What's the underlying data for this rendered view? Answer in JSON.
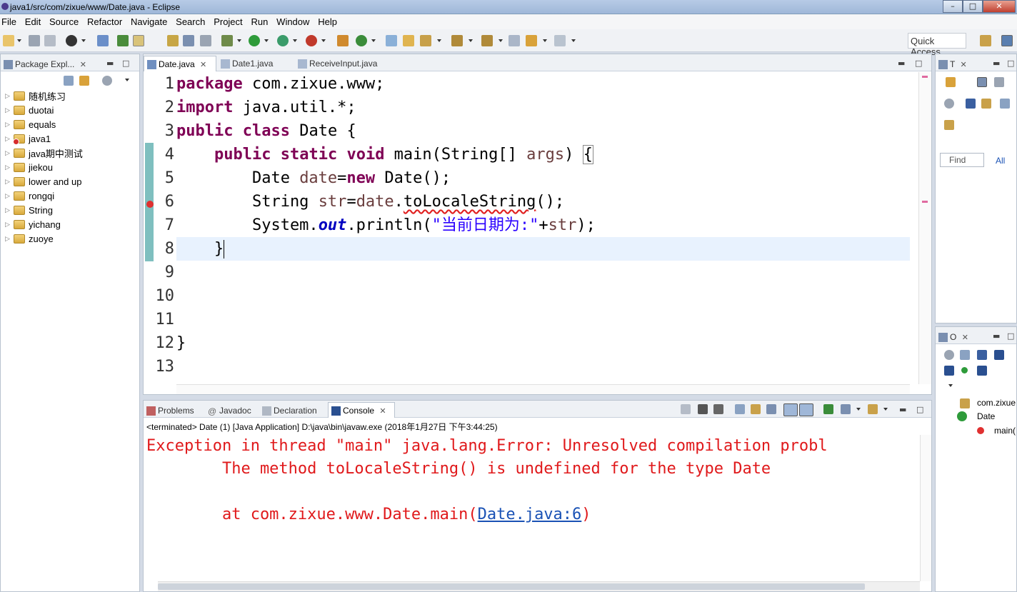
{
  "window": {
    "title": "java1/src/com/zixue/www/Date.java - Eclipse",
    "min_label": "–",
    "max_label": "□",
    "close_label": "✕"
  },
  "menu": [
    "File",
    "Edit",
    "Source",
    "Refactor",
    "Navigate",
    "Search",
    "Project",
    "Run",
    "Window",
    "Help"
  ],
  "toolbar": {
    "quick_access": "Quick Access"
  },
  "package_explorer": {
    "tab_label": "Package Expl...",
    "items": [
      {
        "label": "随机练习",
        "error": false
      },
      {
        "label": "duotai",
        "error": false
      },
      {
        "label": "equals",
        "error": false
      },
      {
        "label": "java1",
        "error": true
      },
      {
        "label": "java期中测试",
        "error": false
      },
      {
        "label": "jiekou",
        "error": false
      },
      {
        "label": "lower and up",
        "error": false
      },
      {
        "label": "rongqi",
        "error": false
      },
      {
        "label": "String",
        "error": false
      },
      {
        "label": "yichang",
        "error": false
      },
      {
        "label": "zuoye",
        "error": false
      }
    ]
  },
  "editor": {
    "tabs": [
      {
        "label": "Date.java",
        "active": true
      },
      {
        "label": "Date1.java",
        "active": false
      },
      {
        "label": "ReceiveInput.java",
        "active": false
      }
    ],
    "line_numbers": [
      "1",
      "2",
      "3",
      "4",
      "5",
      "6",
      "7",
      "8",
      "9",
      "10",
      "11",
      "12",
      "13"
    ],
    "current_line": 8,
    "error_line": 6
  },
  "right_panel": {
    "tab_label": "T",
    "find_label": "Find",
    "all_label": "All"
  },
  "outline": {
    "tab_label": "O",
    "items": [
      "com.zixue",
      "Date",
      "main("
    ]
  },
  "console": {
    "tabs": [
      {
        "label": "Problems",
        "active": false
      },
      {
        "label": "Javadoc",
        "active": false
      },
      {
        "label": "Declaration",
        "active": false
      },
      {
        "label": "Console",
        "active": true
      }
    ],
    "status": "<terminated> Date (1) [Java Application] D:\\java\\bin\\javaw.exe (2018年1月27日 下午3:44:25)",
    "line1": "Exception in thread \"main\" java.lang.Error: Unresolved compilation probl",
    "line2": "        The method toLocaleString() is undefined for the type Date",
    "line3": "",
    "line4_prefix": "        at com.zixue.www.Date.main(",
    "line4_link": "Date.java:6",
    "line4_suffix": ")"
  }
}
